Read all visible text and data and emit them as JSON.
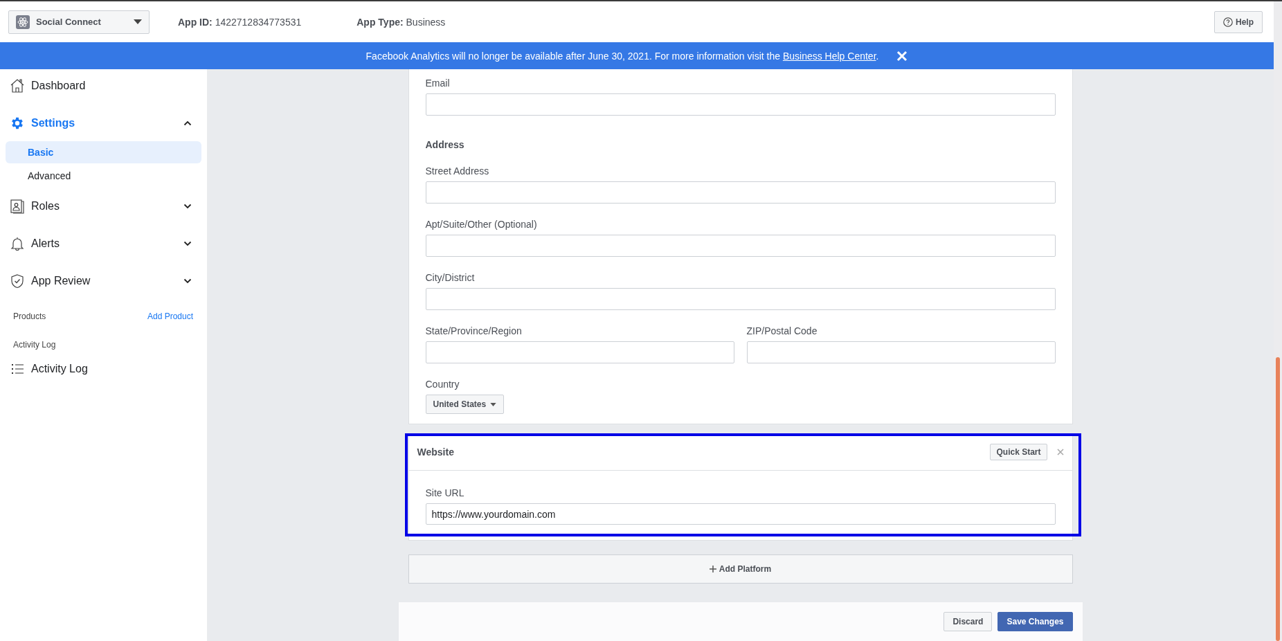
{
  "header": {
    "app_name": "Social Connect",
    "app_id_label": "App ID:",
    "app_id": "1422712834773531",
    "app_type_label": "App Type:",
    "app_type": "Business",
    "help": "Help"
  },
  "banner": {
    "text": "Facebook Analytics will no longer be available after June 30, 2021. For more information visit the ",
    "link": "Business Help Center",
    "suffix": "."
  },
  "sidebar": {
    "nav": [
      {
        "label": "Dashboard",
        "selected": false
      },
      {
        "label": "Settings",
        "selected": true,
        "expanded": true,
        "children": [
          {
            "label": "Basic",
            "selected": true
          },
          {
            "label": "Advanced",
            "selected": false
          }
        ]
      },
      {
        "label": "Roles",
        "selected": false,
        "expanded": false
      },
      {
        "label": "Alerts",
        "selected": false,
        "expanded": false
      },
      {
        "label": "App Review",
        "selected": false,
        "expanded": false
      }
    ],
    "products": {
      "title": "Products",
      "action": "Add Product"
    },
    "activity": {
      "title": "Activity Log",
      "items": [
        {
          "label": "Activity Log"
        }
      ]
    }
  },
  "basic_form": {
    "fields": [
      {
        "kind": "text",
        "label": "Email"
      },
      {
        "kind": "heading",
        "label": "Address"
      },
      {
        "kind": "text",
        "label": "Street Address"
      },
      {
        "kind": "text",
        "label": "Apt/Suite/Other (Optional)"
      },
      {
        "kind": "text",
        "label": "City/District"
      },
      {
        "kind": "pair",
        "fields": [
          {
            "label": "State/Province/Region"
          },
          {
            "label": "ZIP/Postal Code"
          }
        ]
      },
      {
        "kind": "select",
        "label": "Country",
        "value": "United States"
      }
    ]
  },
  "website": {
    "title": "Website",
    "highlighted": true,
    "quick_start": "Quick Start",
    "field_label": "Site URL",
    "value": "https://www.yourdomain.com"
  },
  "add_platform": "Add Platform",
  "footer": {
    "discard": "Discard",
    "save": "Save Changes"
  }
}
